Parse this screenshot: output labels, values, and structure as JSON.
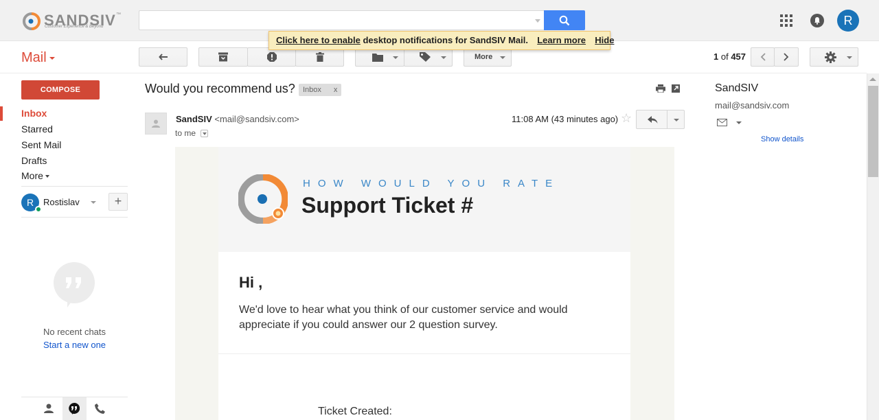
{
  "brand": {
    "name": "SANDSIV",
    "tm": "™",
    "tagline": "Customer Experience & Beyond"
  },
  "search": {
    "value": "",
    "placeholder": ""
  },
  "user": {
    "initial": "R",
    "name": "Rostislav"
  },
  "notification": {
    "link_text": "Click here to enable",
    "text": "desktop notifications for SandSIV Mail.",
    "learn_more": "Learn more",
    "hide": "Hide"
  },
  "app": {
    "label": "Mail"
  },
  "toolbar": {
    "more_label": "More"
  },
  "pager": {
    "current": "1",
    "of_label": "of",
    "total": "457"
  },
  "compose_label": "COMPOSE",
  "nav": [
    {
      "label": "Inbox",
      "active": true
    },
    {
      "label": "Starred"
    },
    {
      "label": "Sent Mail"
    },
    {
      "label": "Drafts"
    },
    {
      "label": "More"
    }
  ],
  "chat": {
    "empty_text": "No recent chats",
    "start_link": "Start a new one"
  },
  "conversation": {
    "subject": "Would you recommend us?",
    "label": "Inbox",
    "label_close": "x",
    "sender_name": "SandSIV",
    "sender_email": "<mail@sandsiv.com>",
    "to": "to me",
    "time": "11:08 AM (43 minutes ago)"
  },
  "email": {
    "rate_heading": "HOW WOULD YOU RATE",
    "title": "Support Ticket #",
    "greeting": "Hi ,",
    "message": "We'd love to hear what you think of our customer service and would appreciate if you could answer our 2 question survey.",
    "ticket_created": "Ticket Created:"
  },
  "contact": {
    "name": "SandSIV",
    "email": "mail@sandsiv.com",
    "details_link": "Show details"
  },
  "colors": {
    "accent_red": "#dd4b39",
    "compose": "#d14836",
    "search_blue": "#4285f4",
    "link": "#1155cc",
    "avatar": "#1a73b8",
    "online": "#0f9d58"
  }
}
